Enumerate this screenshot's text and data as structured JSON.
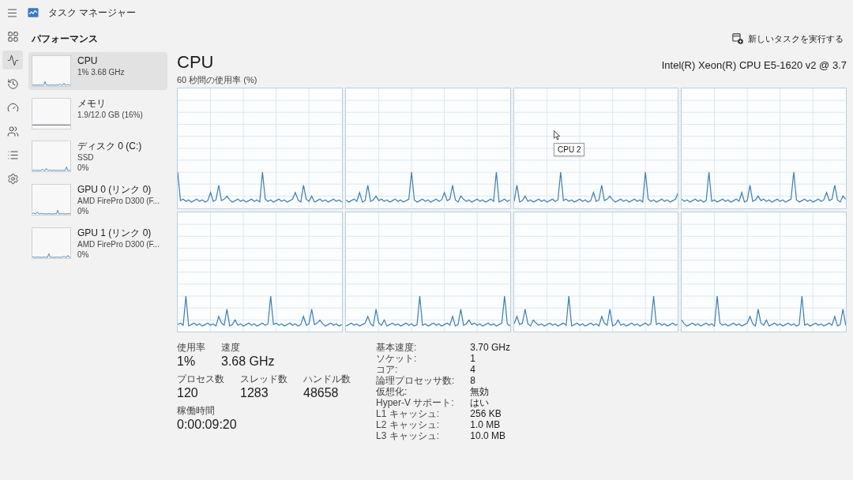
{
  "window": {
    "title": "タスク マネージャー"
  },
  "nav": [
    {
      "kind": "processes",
      "selected": false
    },
    {
      "kind": "performance",
      "selected": true
    },
    {
      "kind": "app_history",
      "selected": false
    },
    {
      "kind": "startup",
      "selected": false
    },
    {
      "kind": "users",
      "selected": false
    },
    {
      "kind": "details",
      "selected": false
    },
    {
      "kind": "services",
      "selected": false
    }
  ],
  "header": {
    "title": "パフォーマンス",
    "run_task_button": "新しいタスクを実行する"
  },
  "sidebar": {
    "items": [
      {
        "kind": "cpu",
        "name": "CPU",
        "lines": [
          "1% 3.68 GHz"
        ],
        "selected": true
      },
      {
        "kind": "memory",
        "name": "メモリ",
        "lines": [
          "1.9/12.0 GB (16%)"
        ],
        "selected": false
      },
      {
        "kind": "disk",
        "name": "ディスク 0 (C:)",
        "lines": [
          "SSD",
          "0%"
        ],
        "selected": false
      },
      {
        "kind": "gpu",
        "name": "GPU 0 (リンク 0)",
        "lines": [
          "AMD FirePro D300 (F...",
          "0%"
        ],
        "selected": false
      },
      {
        "kind": "gpu",
        "name": "GPU 1 (リンク 0)",
        "lines": [
          "AMD FirePro D300 (F...",
          "0%"
        ],
        "selected": false
      }
    ]
  },
  "detail": {
    "title": "CPU",
    "model": "Intel(R) Xeon(R) CPU E5-1620 v2 @ 3.7",
    "graph_label": "60 秒間の使用率 (%)",
    "tooltip": "CPU 2",
    "stats": [
      [
        {
          "label": "使用率",
          "value": "1%"
        },
        {
          "label": "速度",
          "value": "3.68 GHz"
        }
      ],
      [
        {
          "label": "プロセス数",
          "value": "120"
        },
        {
          "label": "スレッド数",
          "value": "1283"
        },
        {
          "label": "ハンドル数",
          "value": "48658"
        }
      ],
      [
        {
          "label": "稼働時間",
          "value": "0:00:09:20"
        }
      ]
    ],
    "specs": [
      {
        "label": "基本速度:",
        "value": "3.70 GHz"
      },
      {
        "label": "ソケット:",
        "value": "1"
      },
      {
        "label": "コア:",
        "value": "4"
      },
      {
        "label": "論理プロセッサ数:",
        "value": "8"
      },
      {
        "label": "仮想化:",
        "value": "無効"
      },
      {
        "label": "Hyper-V サポート:",
        "value": "はい"
      },
      {
        "label": "L1 キャッシュ:",
        "value": "256 KB"
      },
      {
        "label": "L2 キャッシュ:",
        "value": "1.0 MB"
      },
      {
        "label": "L3 キャッシュ:",
        "value": "10.0 MB"
      }
    ]
  }
}
